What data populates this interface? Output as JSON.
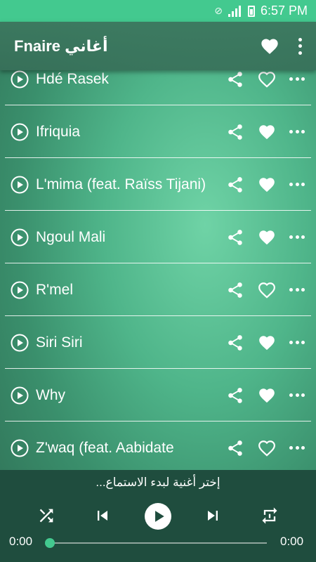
{
  "status_bar": {
    "time": "6:57 PM"
  },
  "app_bar": {
    "title": "Fnaire أغاني"
  },
  "songs": [
    {
      "title": "Hdé Rasek",
      "favorite": false
    },
    {
      "title": "Ifriquia",
      "favorite": true
    },
    {
      "title": "L'mima (feat. Raïss Tijani)",
      "favorite": true
    },
    {
      "title": "Ngoul Mali",
      "favorite": true
    },
    {
      "title": "R'mel",
      "favorite": false
    },
    {
      "title": "Siri Siri",
      "favorite": true
    },
    {
      "title": "Why",
      "favorite": true
    },
    {
      "title": "Z'waq (feat. Aabidate",
      "favorite": false
    }
  ],
  "player": {
    "prompt": "إختر أغنية لبدء الاستماع...",
    "current_time": "0:00",
    "total_time": "0:00",
    "progress": 0
  },
  "colors": {
    "accent": "#43c98f",
    "player_bg": "#1f4d3e"
  }
}
